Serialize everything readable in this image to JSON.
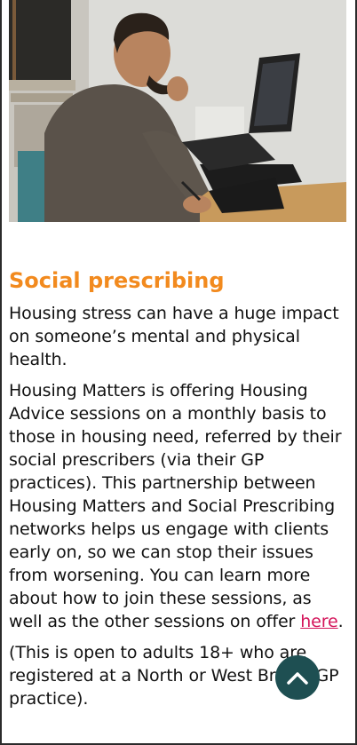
{
  "image": {
    "alt": ""
  },
  "section": {
    "title": "Social prescribing",
    "paragraphs": [
      "Housing stress can have a huge impact on someone’s mental and physical health.",
      "Housing Matters is offering Housing Advice sessions on a monthly basis to those in housing need, referred by their social prescribers (via their GP practices). This partnership between Housing Matters and Social Prescribing networks helps us engage with clients early on, so we can stop their issues from worsening. You can learn more about how to join these sessions, as well as the other sessions on offer ",
      "(This is open to adults 18+ who are registered at a North or West Bristol GP practice)."
    ],
    "link_label": "here",
    "after_link": "."
  },
  "back_to_top": {
    "icon": "chevron-up-icon"
  },
  "colors": {
    "accent": "#f28a1e",
    "link": "#d4145a",
    "fab": "#1e4f52"
  }
}
